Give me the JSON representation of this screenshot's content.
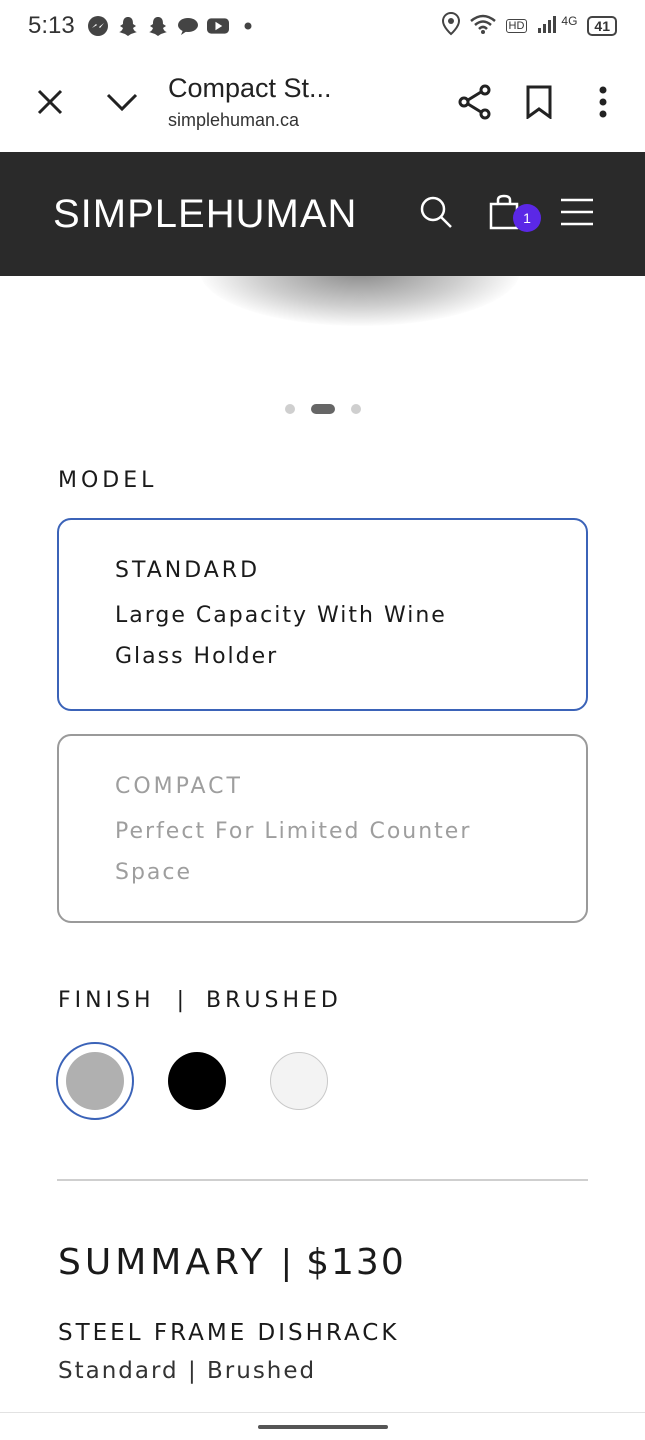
{
  "status_bar": {
    "time": "5:13",
    "network": "4G",
    "hd": "HD",
    "battery": "41"
  },
  "browser": {
    "title": "Compact St...",
    "url": "simplehuman.ca"
  },
  "site": {
    "brand": "SIMPLEHUMAN",
    "cart_count": "1"
  },
  "carousel": {
    "total": 3,
    "active_index": 1
  },
  "model": {
    "label": "MODEL",
    "options": [
      {
        "title": "STANDARD",
        "desc_line1": "Large Capacity With Wine",
        "desc_line2": "Glass Holder",
        "selected": true
      },
      {
        "title": "COMPACT",
        "desc_line1": "Perfect For Limited Counter",
        "desc_line2": "Space",
        "selected": false
      }
    ]
  },
  "finish": {
    "label": "FINISH",
    "separator": "|",
    "selected": "BRUSHED",
    "swatches": [
      {
        "name": "brushed",
        "color": "#b0b0b0",
        "selected": true
      },
      {
        "name": "black",
        "color": "#000000",
        "selected": false
      },
      {
        "name": "white",
        "color": "#f3f3f3",
        "selected": false
      }
    ]
  },
  "summary": {
    "title": "SUMMARY",
    "separator": "|",
    "price": "$130",
    "product_name": "STEEL FRAME DISHRACK",
    "variant": "Standard | Brushed"
  },
  "colors": {
    "header_bg": "#2a2a2a",
    "selected_border": "#3b63b8",
    "cart_badge": "#5b28e6"
  }
}
